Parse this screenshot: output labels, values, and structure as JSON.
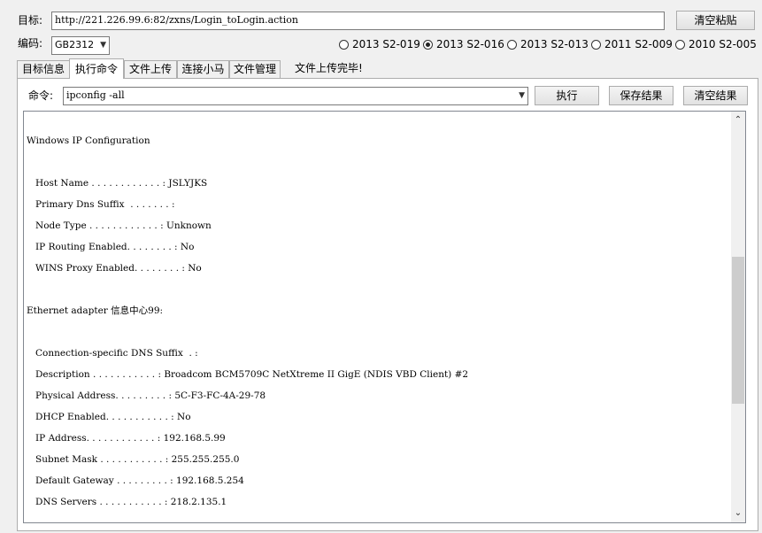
{
  "target": {
    "label": "目标:",
    "url": "http://221.226.99.6:82/zxns/Login_toLogin.action",
    "clear_paste_button": "清空粘贴"
  },
  "encoding": {
    "label": "编码:",
    "value": "GB2312"
  },
  "versions": [
    {
      "label": "2013 S2-019",
      "selected": false
    },
    {
      "label": "2013 S2-016",
      "selected": true
    },
    {
      "label": "2013 S2-013",
      "selected": false
    },
    {
      "label": "2011 S2-009",
      "selected": false
    },
    {
      "label": "2010 S2-005",
      "selected": false
    }
  ],
  "tabs": [
    {
      "label": "目标信息",
      "active": false
    },
    {
      "label": "执行命令",
      "active": true
    },
    {
      "label": "文件上传",
      "active": false
    },
    {
      "label": "连接小马",
      "active": false
    },
    {
      "label": "文件管理",
      "active": false
    }
  ],
  "status_message": "文件上传完毕!",
  "command": {
    "label": "命令:",
    "value": "ipconfig -all",
    "execute_button": "执行",
    "save_button": "保存结果",
    "clear_button": "清空结果"
  },
  "output_lines": [
    "Windows IP Configuration",
    "   Host Name . . . . . . . . . . . . : JSLYJKS",
    "   Primary Dns Suffix  . . . . . . . :",
    "   Node Type . . . . . . . . . . . . : Unknown",
    "   IP Routing Enabled. . . . . . . . : No",
    "   WINS Proxy Enabled. . . . . . . . : No",
    "Ethernet adapter 信息中心99:",
    "   Connection-specific DNS Suffix  . :",
    "   Description . . . . . . . . . . . : Broadcom BCM5709C NetXtreme II GigE (NDIS VBD Client) #2",
    "   Physical Address. . . . . . . . . : 5C-F3-FC-4A-29-78",
    "   DHCP Enabled. . . . . . . . . . . : No",
    "   IP Address. . . . . . . . . . . . : 192.168.5.99",
    "   Subnet Mask . . . . . . . . . . . : 255.255.255.0",
    "   Default Gateway . . . . . . . . . : 192.168.5.254",
    "   DNS Servers . . . . . . . . . . . : 218.2.135.1"
  ],
  "icons": {
    "dropdown": "chevron-down-icon",
    "scroll_up": "scroll-up-icon",
    "scroll_down": "scroll-down-icon"
  }
}
